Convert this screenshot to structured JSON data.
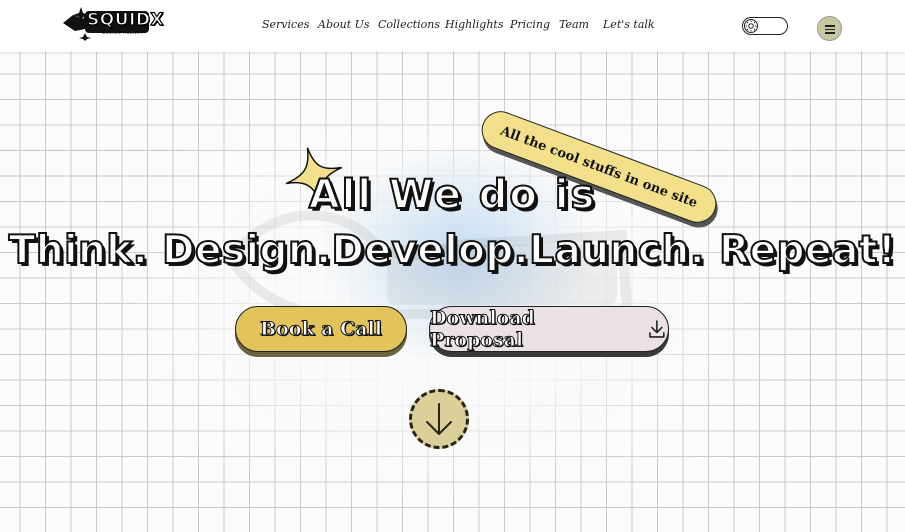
{
  "brand": {
    "name": "SQUIDX",
    "tagline": "DESIGN AGENCY"
  },
  "nav": {
    "items": [
      {
        "label": "Services"
      },
      {
        "label": "About Us"
      },
      {
        "label": "Collections"
      },
      {
        "label": "Highlights"
      },
      {
        "label": "Pricing"
      },
      {
        "label": "Team"
      },
      {
        "label": "Let's talk"
      }
    ]
  },
  "header_controls": {
    "theme_toggle_icon": "sun-icon",
    "menu_icon": "hamburger-icon"
  },
  "hero": {
    "tag_pill": "All the cool stuffs in one site",
    "line1": "All We do is",
    "line2": "Think. Design.Develop.Launch. Repeat!",
    "primary_button": "Book a Call",
    "secondary_button": "Download Proposal",
    "secondary_button_icon": "download-icon",
    "scroll_icon": "arrow-down-icon"
  },
  "colors": {
    "accent_yellow": "#e3c45a",
    "pill_yellow": "#f3e08a",
    "secondary_pink": "#ece2e6",
    "scroll_olive": "#d9d09a"
  }
}
